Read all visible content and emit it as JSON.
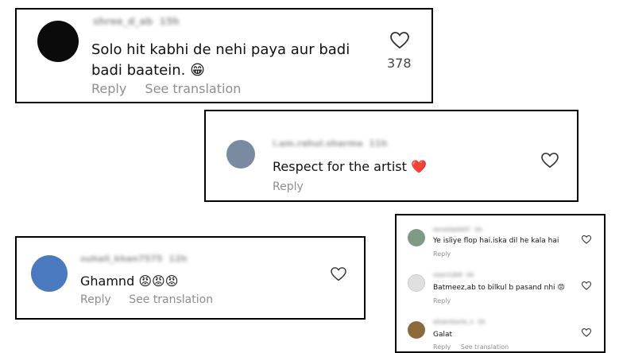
{
  "comments": [
    {
      "username": "shree_d_ab",
      "time": "15h",
      "text_line1": "Solo hit kabhi de nehi paya aur badi",
      "text_line2": "badi baatein.",
      "emoji": "😁",
      "likes": "378",
      "reply": "Reply",
      "translate": "See translation",
      "avatar_color": "#0b0b0b"
    },
    {
      "username": "i.am.rahul.sharma",
      "time": "11h",
      "text": "Respect for the artist",
      "emoji": "❤️",
      "reply": "Reply",
      "avatar_color": "#7a8aa0"
    },
    {
      "username": "suhail_khan7575",
      "time": "12h",
      "text": "Ghamnd",
      "emoji": "😡😡😡",
      "reply": "Reply",
      "translate": "See translation",
      "avatar_color": "#4a79c0"
    }
  ],
  "mini_comments": [
    {
      "username": "mrvelanh07",
      "time": "1h",
      "text": "Ye isliye flop hai.iska dil he kala hai",
      "reply": "Reply",
      "avatar_color": "#7f9b86"
    },
    {
      "username": "user12k8",
      "time": "1h",
      "text": "Batmeez,ab to bilkul b pasand nhi",
      "emoji": "😡",
      "reply": "Reply",
      "avatar_color": "#e0e0e0"
    },
    {
      "username": "alvaroiurio_v",
      "time": "1h",
      "text": "Galat",
      "reply": "Reply",
      "translate": "See translation",
      "avatar_color": "#8a6a3a"
    }
  ],
  "icons": {
    "like": "heart-outline-icon"
  }
}
